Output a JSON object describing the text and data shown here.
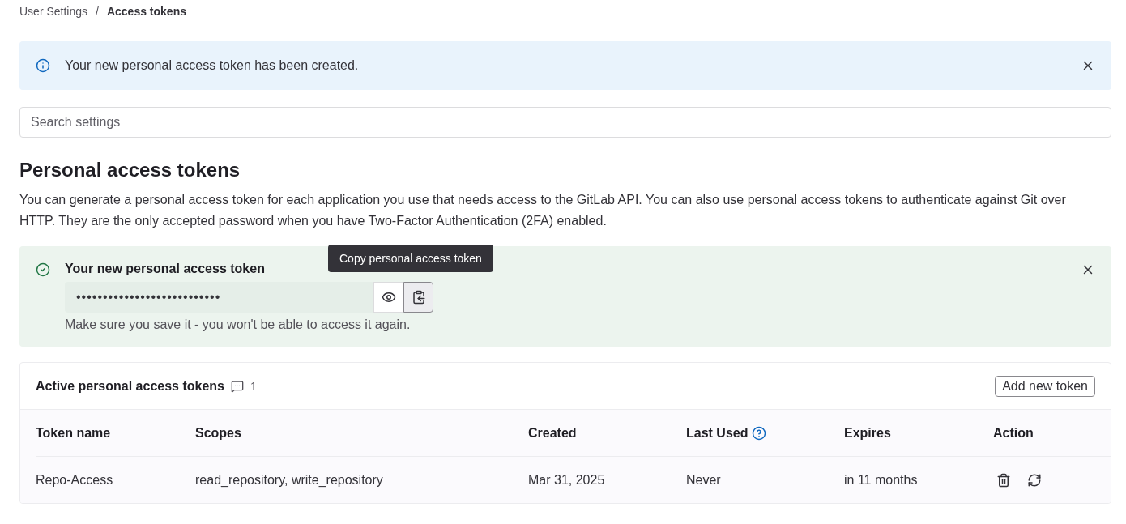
{
  "breadcrumb": {
    "separator": "/",
    "items": [
      {
        "label": "User Settings",
        "current": false
      },
      {
        "label": "Access tokens",
        "current": true
      }
    ]
  },
  "info_alert": {
    "message": "Your new personal access token has been created."
  },
  "search": {
    "placeholder": "Search settings"
  },
  "section": {
    "title": "Personal access tokens",
    "description": "You can generate a personal access token for each application you use that needs access to the GitLab API. You can also use personal access tokens to authenticate against Git over HTTP. They are the only accepted password when you have Two-Factor Authentication (2FA) enabled."
  },
  "new_token": {
    "title": "Your new personal access token",
    "value": "•••••••••••••••••••••••••••",
    "tooltip": "Copy personal access token",
    "hint": "Make sure you save it - you won't be able to access it again."
  },
  "active_tokens": {
    "title": "Active personal access tokens",
    "count": "1",
    "add_button": "Add new token",
    "columns": [
      "Token name",
      "Scopes",
      "Created",
      "Last Used",
      "Expires",
      "Action"
    ],
    "rows": [
      {
        "cells": [
          "Repo-Access",
          "read_repository, write_repository",
          "Mar 31, 2025",
          "Never",
          "in 11 months"
        ]
      }
    ]
  }
}
